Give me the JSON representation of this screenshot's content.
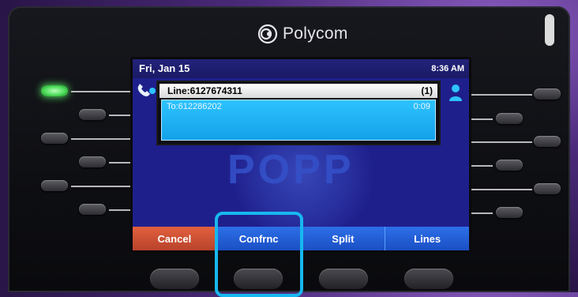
{
  "brand": {
    "name": "Polycom"
  },
  "status": {
    "date": "Fri, Jan 15",
    "time": "8:36 AM"
  },
  "line": {
    "label": "Line:6127674311",
    "count": "(1)"
  },
  "call": {
    "to": "To:612286202",
    "duration": "0:09"
  },
  "watermark": "POPP",
  "softkeys": [
    "Cancel",
    "Confrnc",
    "Split",
    "Lines"
  ],
  "colors": {
    "screen_bg": "#1f1f8c",
    "softkey": "#2d6fe8",
    "cancel": "#c94b30",
    "call_row": "#2ec3ff",
    "highlight": "#17b7ef",
    "led": "#4ddb59"
  },
  "icons": {
    "phone": "handset-icon",
    "person": "person-icon",
    "logo": "polycom-logo-icon"
  }
}
